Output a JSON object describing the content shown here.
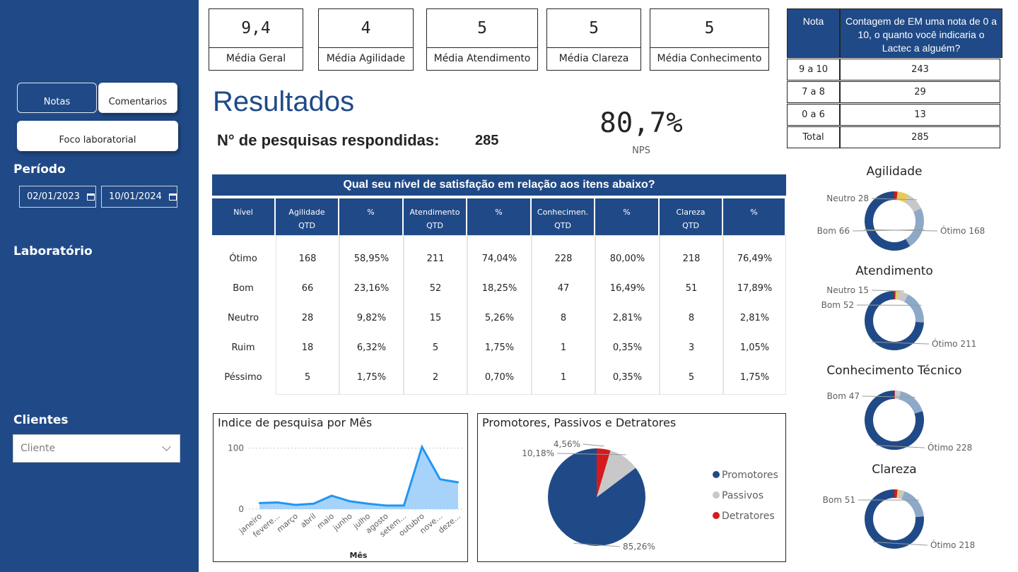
{
  "nav": {
    "notas": "Notas",
    "comentarios": "Comentarios",
    "foco": "Foco laboratorial"
  },
  "filters": {
    "periodo_label": "Período",
    "date_start": "02/01/2023",
    "date_end": "10/01/2024",
    "laboratorio_label": "Laboratório",
    "clientes_label": "Clientes",
    "cliente_placeholder": "Cliente"
  },
  "kpis": [
    {
      "value": "9,4",
      "label": "Média Geral"
    },
    {
      "value": "4",
      "label": "Média Agilidade"
    },
    {
      "value": "5",
      "label": "Média Atendimento"
    },
    {
      "value": "5",
      "label": "Média Clareza"
    },
    {
      "value": "5",
      "label": "Média Conhecimento"
    }
  ],
  "title": "Resultados",
  "responses": {
    "label": "N° de pesquisas respondidas:",
    "value": "285"
  },
  "nps": {
    "value": "80,7%",
    "label": "NPS"
  },
  "satisfaction_table": {
    "title": "Qual seu nível de satisfação em relação aos itens abaixo?",
    "columns": [
      "Nível",
      "Agilidade\nQTD",
      "%",
      "Atendimento\nQTD",
      "%",
      "Conhecimen.\nQTD",
      "%",
      "Clareza\nQTD",
      "%"
    ],
    "rows": [
      [
        "Ótimo",
        "168",
        "58,95%",
        "211",
        "74,04%",
        "228",
        "80,00%",
        "218",
        "76,49%"
      ],
      [
        "Bom",
        "66",
        "23,16%",
        "52",
        "18,25%",
        "47",
        "16,49%",
        "51",
        "17,89%"
      ],
      [
        "Neutro",
        "28",
        "9,82%",
        "15",
        "5,26%",
        "8",
        "2,81%",
        "8",
        "2,81%"
      ],
      [
        "Ruim",
        "18",
        "6,32%",
        "5",
        "1,75%",
        "1",
        "0,35%",
        "3",
        "1,05%"
      ],
      [
        "Péssimo",
        "5",
        "1,75%",
        "2",
        "0,70%",
        "1",
        "0,35%",
        "5",
        "1,75%"
      ]
    ]
  },
  "nps_table": {
    "headers": [
      "Nota",
      "Contagem de EM uma nota de 0 a 10, o quanto você indicaria o Lactec a alguém?"
    ],
    "rows": [
      [
        "9 a 10",
        "243"
      ],
      [
        "7 a 8",
        "29"
      ],
      [
        "0 a 6",
        "13"
      ],
      [
        "Total",
        "285"
      ]
    ]
  },
  "colors": {
    "primary": "#204a87",
    "bom": "#8ea9c8",
    "neutro": "#c8c8c8",
    "ruim": "#e8c95a",
    "pessimo": "#d7191c",
    "line": "#2196f3",
    "area": "#a7d3fb"
  },
  "chart_data": [
    {
      "type": "area",
      "title": "Indice de pesquisa por Mês",
      "xlabel": "Mês",
      "ylabel": "",
      "categories": [
        "janeiro",
        "fevere...",
        "março",
        "abril",
        "maio",
        "junho",
        "julho",
        "agosto",
        "setem...",
        "outubro",
        "nove...",
        "deze..."
      ],
      "values": [
        10,
        11,
        7,
        9,
        22,
        13,
        9,
        6,
        6,
        102,
        49,
        44
      ],
      "ylim": [
        0,
        110
      ],
      "yticks": [
        0,
        100
      ],
      "grid": true
    },
    {
      "type": "pie",
      "title": "Promotores, Passivos e Detratores",
      "categories": [
        "Promotores",
        "Passivos",
        "Detratores"
      ],
      "values": [
        85.26,
        10.18,
        4.56
      ],
      "labels": [
        "85,26%",
        "10,18%",
        "4,56%"
      ],
      "legend": "right"
    },
    {
      "type": "pie",
      "title": "Agilidade",
      "categories": [
        "Ótimo",
        "Bom",
        "Neutro",
        "Ruim",
        "Péssimo"
      ],
      "values": [
        168,
        66,
        28,
        18,
        5
      ],
      "labels": {
        "Ótimo": "Ótimo 168",
        "Bom": "Bom 66",
        "Neutro": "Neutro 28"
      }
    },
    {
      "type": "pie",
      "title": "Atendimento",
      "categories": [
        "Ótimo",
        "Bom",
        "Neutro",
        "Ruim",
        "Péssimo"
      ],
      "values": [
        211,
        52,
        15,
        5,
        2
      ],
      "labels": {
        "Ótimo": "Ótimo 211",
        "Bom": "Bom 52",
        "Neutro": "Neutro 15"
      }
    },
    {
      "type": "pie",
      "title": "Conhecimento Técnico",
      "categories": [
        "Ótimo",
        "Bom",
        "Neutro",
        "Ruim",
        "Péssimo"
      ],
      "values": [
        228,
        47,
        8,
        1,
        1
      ],
      "labels": {
        "Ótimo": "Ótimo 228",
        "Bom": "Bom 47"
      }
    },
    {
      "type": "pie",
      "title": "Clareza",
      "categories": [
        "Ótimo",
        "Bom",
        "Neutro",
        "Ruim",
        "Péssimo"
      ],
      "values": [
        218,
        51,
        8,
        3,
        5
      ],
      "labels": {
        "Ótimo": "Ótimo 218",
        "Bom": "Bom 51"
      }
    }
  ]
}
